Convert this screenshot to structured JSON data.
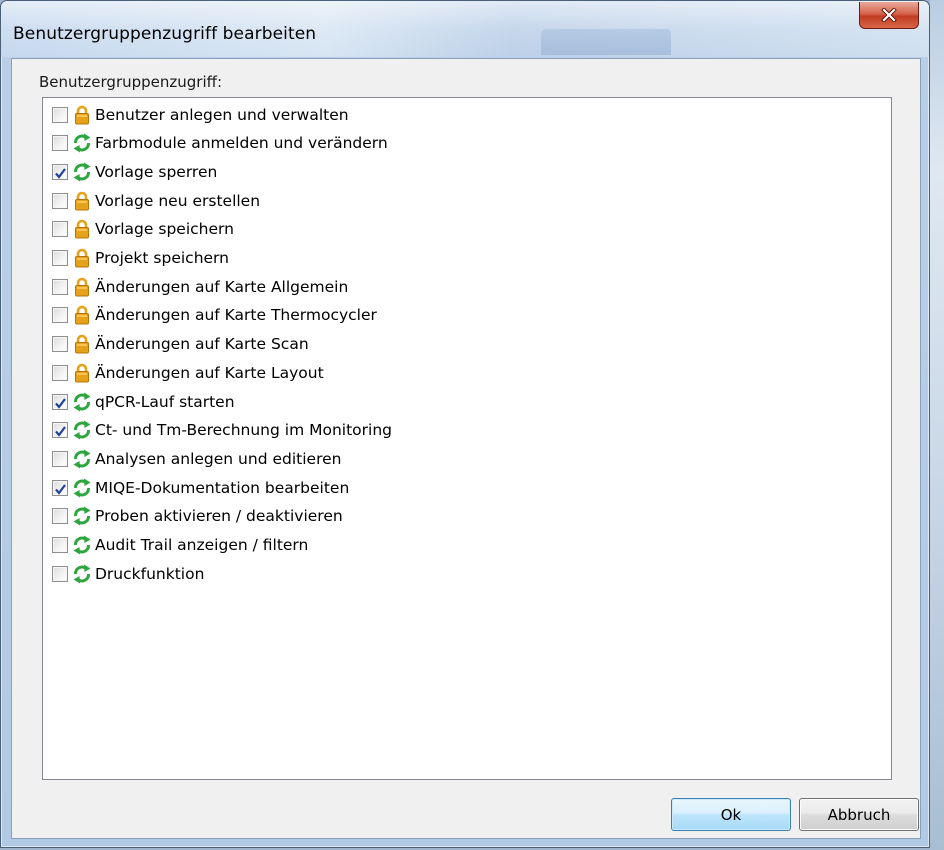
{
  "window": {
    "title": "Benutzergruppenzugriff bearbeiten",
    "close_icon": "close-icon"
  },
  "group_label": "Benutzergruppenzugriff:",
  "colors": {
    "lock_icon": "#e7a21b",
    "refresh_icon": "#2ea640",
    "ok_border": "#3c7fb1",
    "close_button": "#c13d22"
  },
  "permissions": [
    {
      "label": "Benutzer anlegen und verwalten",
      "icon": "lock-icon",
      "checked": false
    },
    {
      "label": "Farbmodule anmelden und verändern",
      "icon": "refresh-icon",
      "checked": false
    },
    {
      "label": "Vorlage sperren",
      "icon": "refresh-icon",
      "checked": true
    },
    {
      "label": "Vorlage neu erstellen",
      "icon": "lock-icon",
      "checked": false
    },
    {
      "label": "Vorlage speichern",
      "icon": "lock-icon",
      "checked": false
    },
    {
      "label": "Projekt speichern",
      "icon": "lock-icon",
      "checked": false
    },
    {
      "label": "Änderungen auf Karte Allgemein",
      "icon": "lock-icon",
      "checked": false
    },
    {
      "label": "Änderungen auf Karte Thermocycler",
      "icon": "lock-icon",
      "checked": false
    },
    {
      "label": "Änderungen auf Karte Scan",
      "icon": "lock-icon",
      "checked": false
    },
    {
      "label": "Änderungen auf Karte Layout",
      "icon": "lock-icon",
      "checked": false
    },
    {
      "label": "qPCR-Lauf starten",
      "icon": "refresh-icon",
      "checked": true
    },
    {
      "label": "Ct- und Tm-Berechnung im Monitoring",
      "icon": "refresh-icon",
      "checked": true
    },
    {
      "label": "Analysen anlegen und editieren",
      "icon": "refresh-icon",
      "checked": false
    },
    {
      "label": "MIQE-Dokumentation bearbeiten",
      "icon": "refresh-icon",
      "checked": true
    },
    {
      "label": "Proben aktivieren / deaktivieren",
      "icon": "refresh-icon",
      "checked": false
    },
    {
      "label": "Audit Trail anzeigen / filtern",
      "icon": "refresh-icon",
      "checked": false
    },
    {
      "label": "Druckfunktion",
      "icon": "refresh-icon",
      "checked": false
    }
  ],
  "buttons": {
    "ok_label": "Ok",
    "cancel_label": "Abbruch"
  }
}
